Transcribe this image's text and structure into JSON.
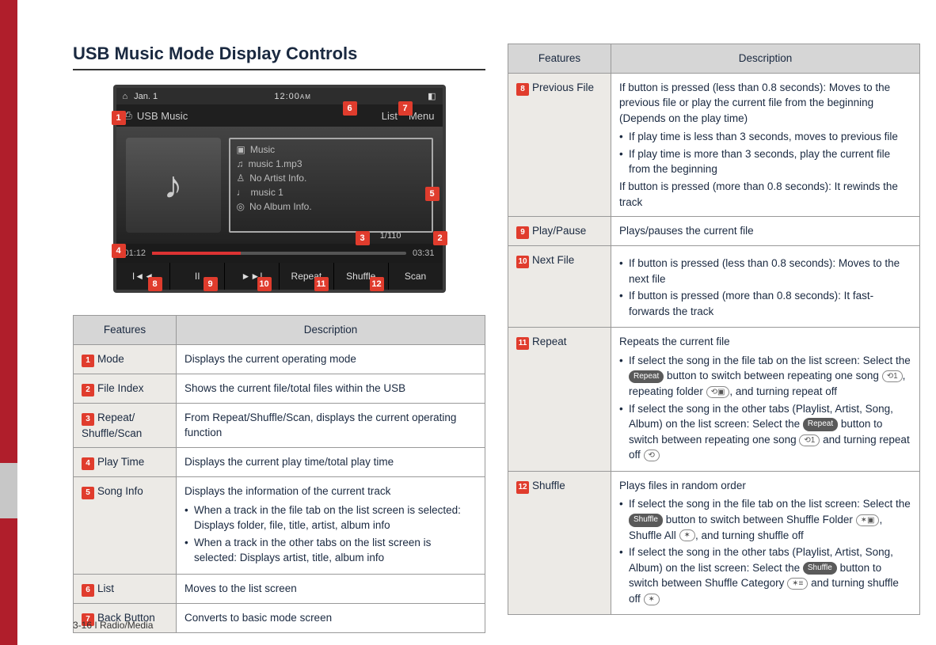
{
  "section_title": "USB Music Mode Display Controls",
  "footer": "3-16 I Radio/Media",
  "screenshot": {
    "status_date": "Jan. 1",
    "status_time": "12:00",
    "status_ampm": "AM",
    "mode_label": "USB Music",
    "list_btn": "List",
    "menu_btn": "Menu",
    "info_music": "Music",
    "info_file": "music 1.mp3",
    "info_artist": "No Artist Info.",
    "info_title": "music 1",
    "info_album": "No Album Info.",
    "index": "1/110",
    "time_elapsed": "01:12",
    "time_total": "03:31",
    "ctrl_prev": "I◄◄",
    "ctrl_pause": "II",
    "ctrl_next": "►►I",
    "ctrl_repeat": "Repeat",
    "ctrl_shuffle": "Shuffle",
    "ctrl_scan": "Scan"
  },
  "table_headers": {
    "features": "Features",
    "description": "Description"
  },
  "rows_left": {
    "r1": {
      "n": "1",
      "f": "Mode",
      "d": "Displays the current operating mode"
    },
    "r2": {
      "n": "2",
      "f": "File Index",
      "d": "Shows the current file/total files within the USB"
    },
    "r3": {
      "n": "3",
      "f": "Repeat/\nShuffle/Scan",
      "d": "From Repeat/Shuffle/Scan, displays the current operating function"
    },
    "r4": {
      "n": "4",
      "f": "Play Time",
      "d": "Displays the current play time/total play time"
    },
    "r5": {
      "n": "5",
      "f": "Song Info",
      "d_intro": "Displays the information of the current track",
      "b1": "When a track in the file tab on the list screen is selected: Displays folder, file, title, artist, album info",
      "b2": "When a track in the other tabs on the list screen is selected: Displays artist, title, album info"
    },
    "r6": {
      "n": "6",
      "f": "List",
      "d": "Moves to the list screen"
    },
    "r7": {
      "n": "7",
      "f": "Back Button",
      "d": "Converts to basic mode screen"
    }
  },
  "rows_right": {
    "r8": {
      "n": "8",
      "f": "Previous File",
      "d_intro": "If button is pressed (less than 0.8 seconds): Moves to the previous file or play the current file from the beginning (Depends on the play time)",
      "b1": "If play time is less than 3 seconds, moves to previous file",
      "b2": "If play time is more than 3 seconds, play the current file from the beginning",
      "d_outro": "If button is pressed (more than 0.8 seconds): It rewinds the track"
    },
    "r9": {
      "n": "9",
      "f": "Play/Pause",
      "d": "Plays/pauses the current file"
    },
    "r10": {
      "n": "10",
      "f": "Next File",
      "b1": "If button is pressed (less than 0.8 seconds): Moves to the next file",
      "b2": "If button is pressed (more than 0.8 seconds): It fast-forwards the track"
    },
    "r11": {
      "n": "11",
      "f": "Repeat",
      "d_intro": "Repeats the current file",
      "pill_repeat": "Repeat",
      "b1a": "If select the song in the file tab on the list screen: Select the ",
      "b1b": " button to switch between repeating one song ",
      "b1c": ", repeating folder ",
      "b1d": ", and turning repeat off",
      "b2a": "If select the song in the other tabs (Playlist, Artist, Song, Album) on the list screen: Select the ",
      "b2b": " button to switch between repeating one song ",
      "b2c": " and turning repeat off "
    },
    "r12": {
      "n": "12",
      "f": "Shuffle",
      "d_intro": "Plays files in random order",
      "pill_shuffle": "Shuffle",
      "b1a": "If select the song in the file tab on the list screen: Select the ",
      "b1b": " button to switch between Shuffle Folder ",
      "b1c": ", Shuffle All ",
      "b1d": ", and turning shuffle off",
      "b2a": "If select the song in the other tabs (Playlist, Artist, Song, Album) on the list screen: Select the ",
      "b2b": " button to switch between Shuffle Category ",
      "b2c": " and turning shuffle off "
    }
  },
  "icons": {
    "repeat_one": "⟲1",
    "repeat_folder": "⟲▣",
    "repeat_off": "⟲",
    "shuffle_folder": "✶▣",
    "shuffle_all": "✶",
    "shuffle_cat": "✶≡"
  }
}
